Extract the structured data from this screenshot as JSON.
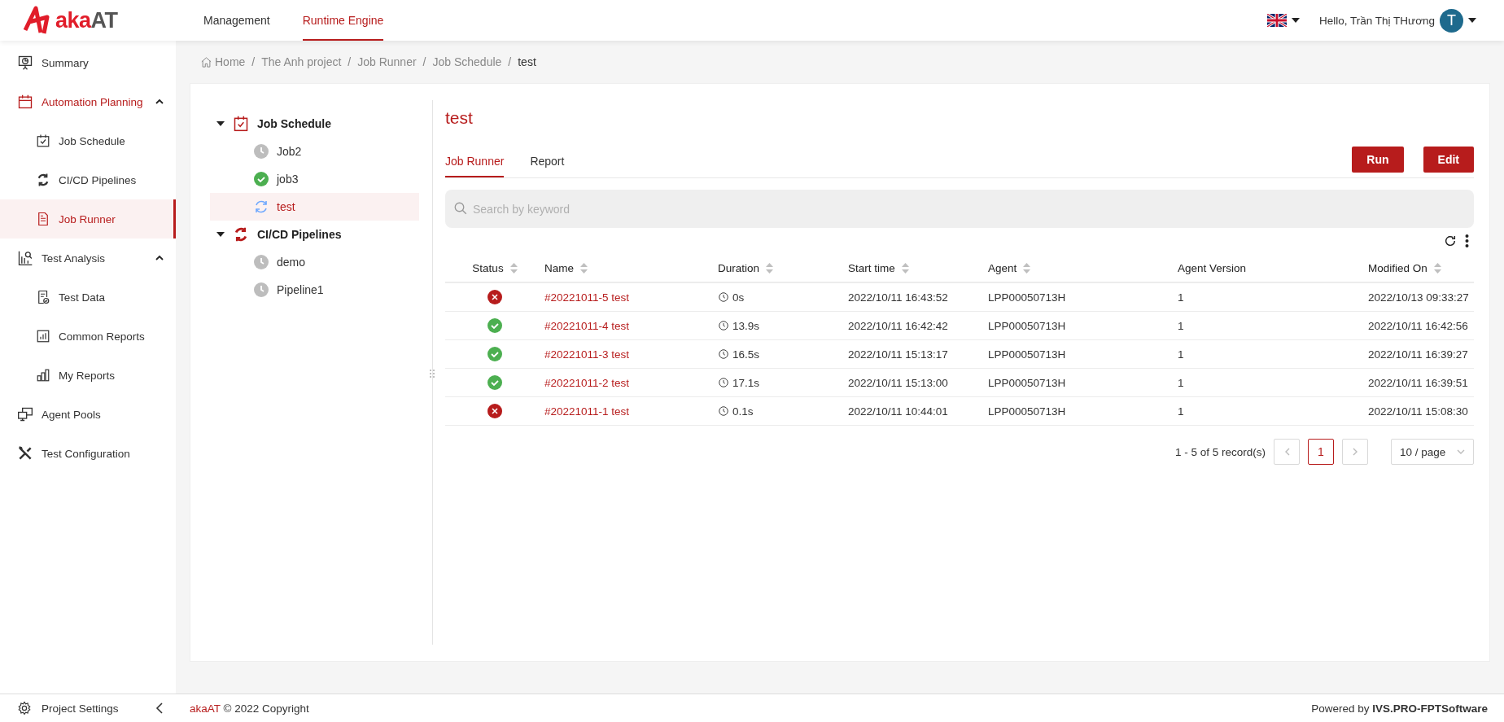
{
  "header": {
    "logo": {
      "part_1": "aka",
      "part_2": "AT"
    },
    "nav": [
      {
        "label": "Management",
        "selected": false
      },
      {
        "label": "Runtime Engine",
        "selected": true
      }
    ],
    "greeting": "Hello, Trần Thị THương",
    "avatar": "T"
  },
  "sidebar": {
    "items": [
      {
        "label": "Summary",
        "selected": false
      },
      {
        "label": "Automation Planning",
        "selected": true,
        "expanded": true,
        "children": [
          {
            "label": "Job Schedule",
            "selected": false
          },
          {
            "label": "CI/CD Pipelines",
            "selected": false
          },
          {
            "label": "Job Runner",
            "selected": true
          }
        ]
      },
      {
        "label": "Test Analysis",
        "selected": false,
        "expanded": true,
        "children": [
          {
            "label": "Test Data",
            "selected": false
          },
          {
            "label": "Common Reports",
            "selected": false
          },
          {
            "label": "My Reports",
            "selected": false
          }
        ]
      },
      {
        "label": "Agent Pools",
        "selected": false
      },
      {
        "label": "Test Configuration",
        "selected": false
      }
    ],
    "settings": "Project Settings"
  },
  "breadcrumb": {
    "separator": "/",
    "items": [
      "Home",
      "The Anh project",
      "Job Runner",
      "Job Schedule",
      "test"
    ]
  },
  "tree": [
    {
      "label": "Job Schedule",
      "expanded": true,
      "children": [
        {
          "label": "Job2",
          "kind": "idle",
          "selected": false
        },
        {
          "label": "job3",
          "kind": "success",
          "selected": false
        },
        {
          "label": "test",
          "kind": "running",
          "selected": true
        }
      ]
    },
    {
      "label": "CI/CD Pipelines",
      "expanded": true,
      "children": [
        {
          "label": "demo",
          "kind": "idle",
          "selected": false
        },
        {
          "label": "Pipeline1",
          "kind": "idle",
          "selected": false
        }
      ]
    }
  ],
  "title": "test",
  "tabs": [
    {
      "label": "Job Runner",
      "selected": true
    },
    {
      "label": "Report",
      "selected": false
    }
  ],
  "buttons": [
    "Run",
    "Edit"
  ],
  "search": {
    "placeholder": "Search by keyword"
  },
  "table": {
    "columns": [
      {
        "label": "Status",
        "sortable": true
      },
      {
        "label": "Name",
        "sortable": true
      },
      {
        "label": "Duration",
        "sortable": true
      },
      {
        "label": "Start time",
        "sortable": true
      },
      {
        "label": "Agent",
        "sortable": true
      },
      {
        "label": "Agent Version",
        "sortable": false
      },
      {
        "label": "Modified On",
        "sortable": true
      }
    ],
    "rows": [
      {
        "kind": "failed",
        "name": "#20221011-5 test",
        "duration": "0s",
        "start": "2022/10/11 16:43:52",
        "agent": "LPP00050713H",
        "version": "1",
        "modified": "2022/10/13 09:33:27"
      },
      {
        "kind": "passed",
        "name": "#20221011-4 test",
        "duration": "13.9s",
        "start": "2022/10/11 16:42:42",
        "agent": "LPP00050713H",
        "version": "1",
        "modified": "2022/10/11 16:42:56"
      },
      {
        "kind": "passed",
        "name": "#20221011-3 test",
        "duration": "16.5s",
        "start": "2022/10/11 15:13:17",
        "agent": "LPP00050713H",
        "version": "1",
        "modified": "2022/10/11 16:39:27"
      },
      {
        "kind": "passed",
        "name": "#20221011-2 test",
        "duration": "17.1s",
        "start": "2022/10/11 15:13:00",
        "agent": "LPP00050713H",
        "version": "1",
        "modified": "2022/10/11 16:39:51"
      },
      {
        "kind": "failed",
        "name": "#20221011-1 test",
        "duration": "0.1s",
        "start": "2022/10/11 10:44:01",
        "agent": "LPP00050713H",
        "version": "1",
        "modified": "2022/10/11 15:08:30"
      }
    ]
  },
  "pagination": {
    "summary": "1 - 5 of 5 record(s)",
    "pages": [
      {
        "label": "1",
        "selected": true
      }
    ],
    "page_size": "10 / page"
  },
  "footer": {
    "brand": "akaAT",
    "copyright": "© 2022 Copyright",
    "powered": "Powered by",
    "company": "IVS.PRO-FPTSoftware"
  }
}
